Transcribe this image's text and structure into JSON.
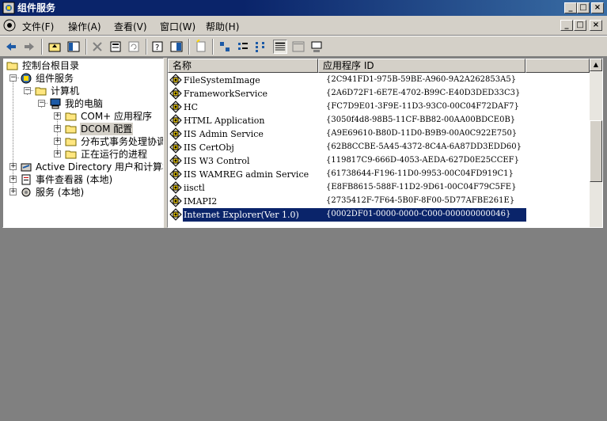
{
  "window": {
    "title": "组件服务"
  },
  "menu": {
    "items": [
      "文件(F)",
      "操作(A)",
      "查看(V)",
      "窗口(W)",
      "帮助(H)"
    ]
  },
  "titlebar_buttons": {
    "minimize": "_",
    "maximize": "□",
    "close": "×"
  },
  "tree": {
    "items": [
      {
        "label": "控制台根目录",
        "icon": "folder-open-icon"
      },
      {
        "label": "组件服务",
        "icon": "globe-icon"
      },
      {
        "label": "计算机",
        "icon": "folder-open-icon"
      },
      {
        "label": "我的电脑",
        "icon": "computer-icon"
      },
      {
        "label": "COM+ 应用程序",
        "icon": "folder-icon"
      },
      {
        "label": "DCOM 配置",
        "icon": "folder-open-icon",
        "selected": true
      },
      {
        "label": "分布式事务处理协调器",
        "icon": "folder-icon"
      },
      {
        "label": "正在运行的进程",
        "icon": "folder-icon"
      },
      {
        "label": "Active Directory 用户和计算机",
        "icon": "ad-icon"
      },
      {
        "label": "事件查看器 (本地)",
        "icon": "event-viewer-icon"
      },
      {
        "label": "服务 (本地)",
        "icon": "services-icon"
      }
    ]
  },
  "list": {
    "columns": {
      "name": "名称",
      "appid": "应用程序 ID"
    },
    "rows": [
      {
        "name": "FileSystemImage",
        "appid": "{2C941FD1-975B-59BE-A960-9A2A262853A5}"
      },
      {
        "name": "FrameworkService",
        "appid": "{2A6D72F1-6E7E-4702-B99C-E40D3DED33C3}"
      },
      {
        "name": "HC",
        "appid": "{FC7D9E01-3F9E-11D3-93C0-00C04F72DAF7}"
      },
      {
        "name": "HTML Application",
        "appid": "{3050f4d8-98B5-11CF-BB82-00AA00BDCE0B}"
      },
      {
        "name": "IIS Admin Service",
        "appid": "{A9E69610-B80D-11D0-B9B9-00A0C922E750}"
      },
      {
        "name": "IIS CertObj",
        "appid": "{62B8CCBE-5A45-4372-8C4A-6A87DD3EDD60}"
      },
      {
        "name": "IIS W3 Control",
        "appid": "{119817C9-666D-4053-AEDA-627D0E25CCEF}"
      },
      {
        "name": "IIS WAMREG admin Service",
        "appid": "{61738644-F196-11D0-9953-00C04FD919C1}"
      },
      {
        "name": "iisctl",
        "appid": "{E8FB8615-588F-11D2-9D61-00C04F79C5FE}"
      },
      {
        "name": "IMAPI2",
        "appid": "{2735412F-7F64-5B0F-8F00-5D77AFBE261E}"
      },
      {
        "name": "Internet Explorer(Ver 1.0)",
        "appid": "{0002DF01-0000-0000-C000-000000000046}",
        "selected": true
      }
    ]
  },
  "colors": {
    "title_bar": "#0a246a",
    "selection": "#0a246a",
    "face": "#d4d0c8",
    "desktop": "#808080"
  }
}
